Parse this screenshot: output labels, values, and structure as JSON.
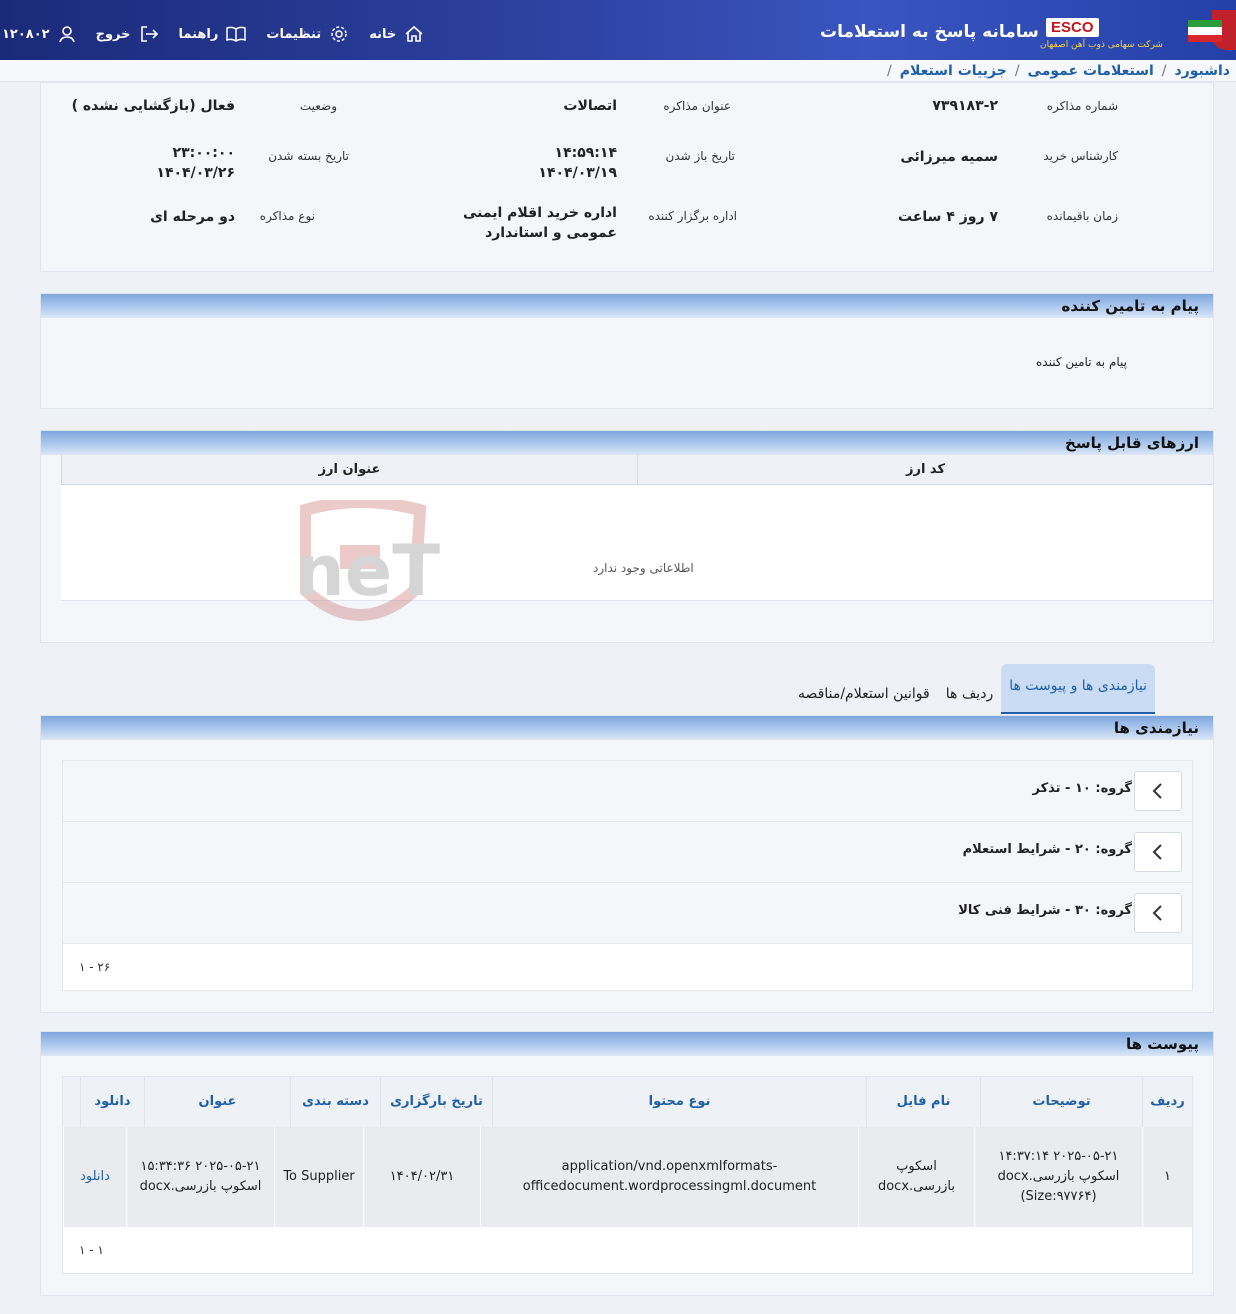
{
  "header": {
    "app_title": "سامانه پاسخ به استعلامات",
    "esco": "ESCO",
    "company": "شرکت سهامی ذوب آهن اصفهان",
    "nav": {
      "home": "خانه",
      "settings": "تنظیمات",
      "help": "راهنما",
      "logout": "خروج",
      "user_id": "۱۲۰۸۰۲"
    }
  },
  "breadcrumb": [
    "داشبورد",
    "استعلامات عمومی",
    "جزییات استعلام"
  ],
  "info": {
    "tender_number_label": "شماره مذاکره",
    "tender_number": "۷۳۹۱۸۳-۲",
    "title_label": "عنوان مذاکره",
    "title": "اتصالات",
    "status_label": "وضعیت",
    "status": "فعال (بازگشایی نشده )",
    "buyer_label": "کارشناس خرید",
    "buyer": "سمیه میرزائی",
    "open_label": "تاریخ باز شدن",
    "open_time": "۱۴:۵۹:۱۴",
    "open_date": "۱۴۰۴/۰۳/۱۹",
    "close_label": "تاریخ بسته شدن",
    "close_time": "۲۳:۰۰:۰۰",
    "close_date": "۱۴۰۴/۰۳/۲۶",
    "remaining_label": "زمان باقیمانده",
    "remaining": "۷ روز ۴ ساعت",
    "org_label": "اداره برگزار کننده",
    "org": "اداره خرید اقلام ایمنی عمومی و استاندارد",
    "type_label": "نوع مذاکره",
    "type": "دو مرحله ای"
  },
  "supplier_msg": {
    "title": "پیام به تامین کننده",
    "body": "پیام به تامین کننده"
  },
  "currency": {
    "title": "ارزهای قابل پاسخ",
    "columns": [
      "کد ارز",
      "عنوان ارز"
    ],
    "empty": "اطلاعاتی وجود ندارد"
  },
  "tabs": [
    "نیازمندی ها و پیوست ها",
    "ردیف ها",
    "قوانین استعلام/مناقصه"
  ],
  "requirements": {
    "title": "نیازمندی ها",
    "groups": [
      "گروه: ۱۰ - تذکر",
      "گروه: ۲۰ - شرایط استعلام",
      "گروه: ۳۰ - شرایط فنی کالا"
    ],
    "pager": "۱ - ۲۶"
  },
  "attachments": {
    "title": "پیوست ها",
    "columns": [
      "ردیف",
      "توضیحات",
      "نام فایل",
      "نوع محتوا",
      "تاریخ بارگزاری",
      "دسته بندی",
      "عنوان",
      "دانلود"
    ],
    "rows": [
      {
        "index": "۱",
        "desc": "۲۰۲۵-۰۵-۲۱ ۱۴:۳۷:۱۴ اسکوپ بازرسی.docx (Size:۹۷۷۶۴)",
        "file": "اسکوپ بازرسی.docx",
        "mime": "application/vnd.openxmlformats-officedocument.wordprocessingml.document",
        "date": "۱۴۰۴/۰۲/۳۱",
        "category": "To Supplier",
        "name": "۲۰۲۵-۰۵-۲۱ ۱۵:۳۴:۳۶ اسکوپ بازرسی.docx",
        "download": "دانلود"
      }
    ],
    "pager": "۱ - ۱"
  },
  "watermark": "AriaTender.neT",
  "colors": {
    "header": "#2b3f9c",
    "link": "#1f5fa8",
    "section": "#7fa7de"
  }
}
